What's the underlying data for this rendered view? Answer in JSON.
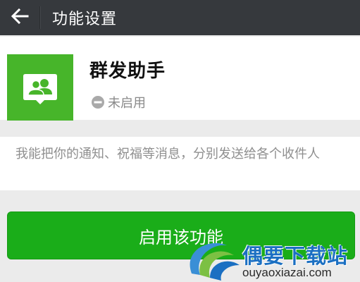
{
  "header": {
    "title": "功能设置",
    "back_icon": "arrow-left-icon"
  },
  "app": {
    "name": "群发助手",
    "status": "未启用",
    "icon": "group-chat-icon",
    "icon_bg_color": "#47b52a"
  },
  "description": "我能把你的通知、祝福等消息，分别发送给各个收件人",
  "actions": {
    "enable_label": "启用该功能",
    "enable_color": "#1aad19"
  },
  "watermark": {
    "brand": "偶要下载站",
    "url": "ouyaoxiazai.com"
  }
}
